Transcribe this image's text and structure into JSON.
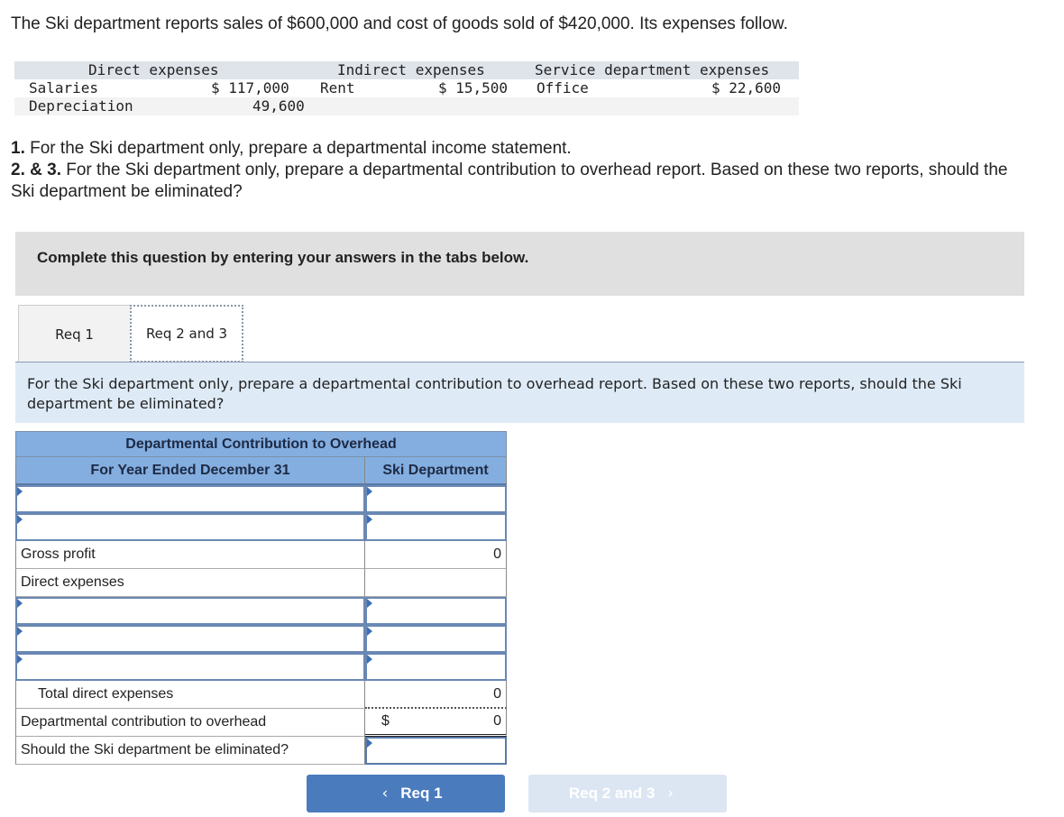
{
  "intro": "The Ski department reports sales of $600,000 and cost of goods sold of $420,000. Its expenses follow.",
  "expenses": {
    "headers": {
      "direct": "Direct expenses",
      "indirect": "Indirect expenses",
      "service": "Service department expenses"
    },
    "rows": [
      {
        "direct_label": "Salaries",
        "direct_value": "$ 117,000",
        "indirect_label": "Rent",
        "indirect_value": "$ 15,500",
        "service_label": "Office",
        "service_value": "$ 22,600"
      },
      {
        "direct_label": "Depreciation",
        "direct_value": "49,600",
        "indirect_label": "",
        "indirect_value": "",
        "service_label": "",
        "service_value": ""
      }
    ]
  },
  "questions": {
    "q1_num": "1.",
    "q1_text": " For the Ski department only, prepare a departmental income statement.",
    "q23_num": "2. & 3.",
    "q23_text": " For the Ski department only, prepare a departmental contribution to overhead report. Based on these two reports, should the Ski department be eliminated?"
  },
  "banner": "Complete this question by entering your answers in the tabs below.",
  "tabs": [
    {
      "label": "Req 1"
    },
    {
      "label": "Req 2 and 3"
    }
  ],
  "prompt": "For the Ski department only, prepare a departmental contribution to overhead report. Based on these two reports, should the Ski department be eliminated?",
  "report": {
    "title": "Departmental Contribution to Overhead",
    "col1_header": "For Year Ended December 31",
    "col2_header": "Ski Department",
    "gross_profit_label": "Gross profit",
    "gross_profit_value": "0",
    "direct_expenses_label": "Direct expenses",
    "total_direct_label": "Total direct expenses",
    "total_direct_value": "0",
    "contribution_label": "Departmental contribution to overhead",
    "contribution_currency": "$",
    "contribution_value": "0",
    "eliminate_label": "Should the Ski department be eliminated?"
  },
  "nav": {
    "prev_label": "Req 1",
    "next_label": "Req 2 and 3",
    "prev_icon": "‹",
    "next_icon": "›"
  }
}
